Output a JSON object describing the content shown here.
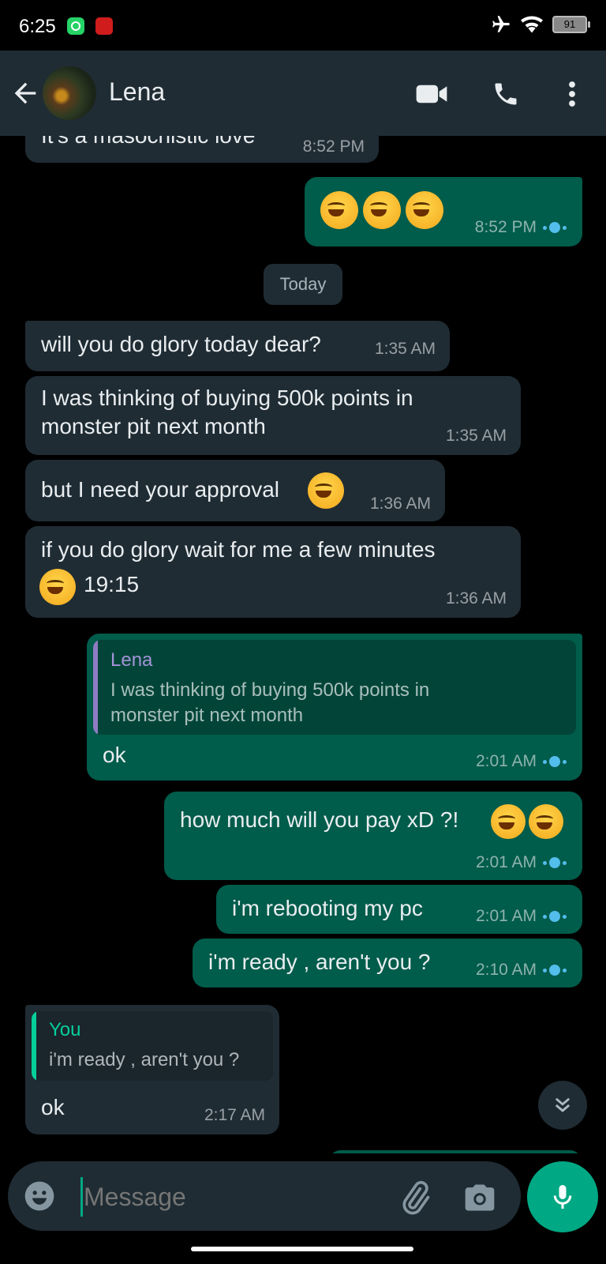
{
  "status_bar": {
    "time": "6:25",
    "battery": "91"
  },
  "header": {
    "contact_name": "Lena"
  },
  "messages": {
    "m1": {
      "text": "It's a masochistic love",
      "time": "8:52 PM"
    },
    "m2": {
      "time": "8:52 PM",
      "emoji_count": 3
    },
    "date_chip": "Today",
    "m3": {
      "text": "will you do glory today dear?",
      "time": "1:35 AM"
    },
    "m4": {
      "line1": "I was thinking of buying 500k points in",
      "line2": "monster pit next month",
      "time": "1:35 AM"
    },
    "m5": {
      "text": "but I need your approval",
      "time": "1:36 AM"
    },
    "m6": {
      "line1": "if you do glory wait for me a few minutes",
      "line2": "19:15",
      "time": "1:36 AM"
    },
    "m7": {
      "quote_name": "Lena",
      "quote_line1": "I was thinking of buying 500k points in",
      "quote_line2": "monster pit next month",
      "text": "ok",
      "time": "2:01 AM"
    },
    "m8": {
      "text": "how much will you pay xD ?!",
      "time": "2:01 AM"
    },
    "m9": {
      "text": "i'm rebooting my pc",
      "time": "2:01 AM"
    },
    "m10": {
      "text": "i'm ready , aren't you ?",
      "time": "2:10 AM"
    },
    "m11": {
      "quote_name": "You",
      "quote_text": "i'm ready , aren't you ?",
      "text": "ok",
      "time": "2:17 AM"
    }
  },
  "composer": {
    "placeholder": "Message"
  },
  "colors": {
    "incoming_bubble": "#1f2c34",
    "outgoing_bubble": "#005c4b",
    "accent": "#00a884",
    "read_ticks": "#53bdeb",
    "quote_lena": "#8e7cc3",
    "quote_you": "#06cf9c"
  },
  "icons": [
    "back-arrow-icon",
    "video-call-icon",
    "voice-call-icon",
    "more-vert-icon",
    "double-chevron-down-icon",
    "emoji-icon",
    "attach-icon",
    "camera-icon",
    "mic-icon",
    "airplane-icon",
    "wifi-icon",
    "battery-icon"
  ]
}
